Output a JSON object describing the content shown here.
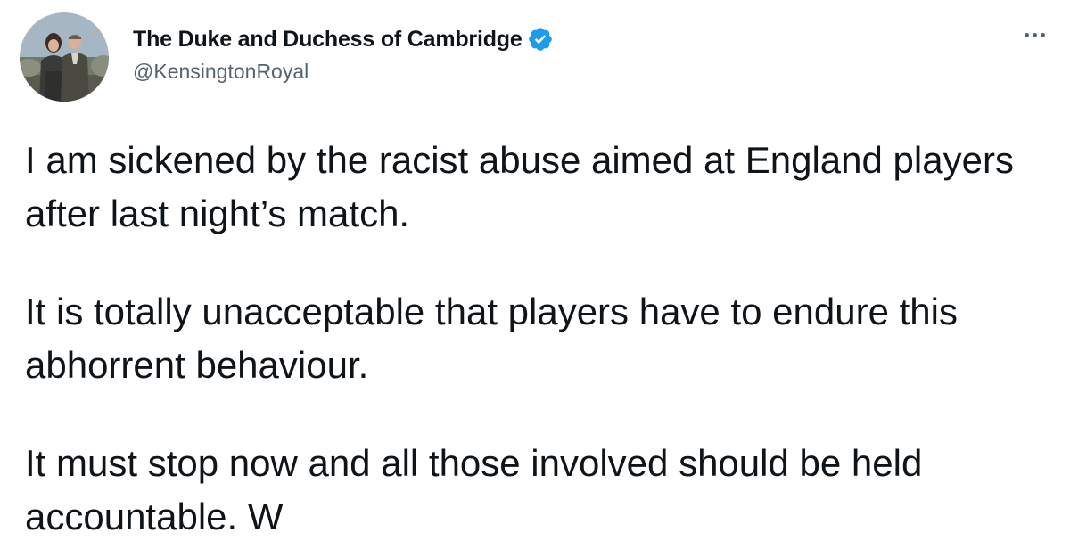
{
  "author": {
    "display_name": "The Duke and Duchess of Cambridge",
    "handle": "@KensingtonRoyal",
    "verified": true,
    "avatar_icon": "profile-photo"
  },
  "tweet": {
    "paragraphs": [
      "I am sickened by the racist abuse aimed at England players after last night’s match.",
      "It is totally unacceptable that players have to endure this abhorrent behaviour.",
      "It must stop now and all those involved should be held accountable. W"
    ]
  },
  "icons": {
    "verified": "verified-badge-icon",
    "more": "more-options-icon"
  },
  "colors": {
    "text": "#0f1419",
    "secondary": "#536471",
    "verified": "#1d9bf0"
  }
}
